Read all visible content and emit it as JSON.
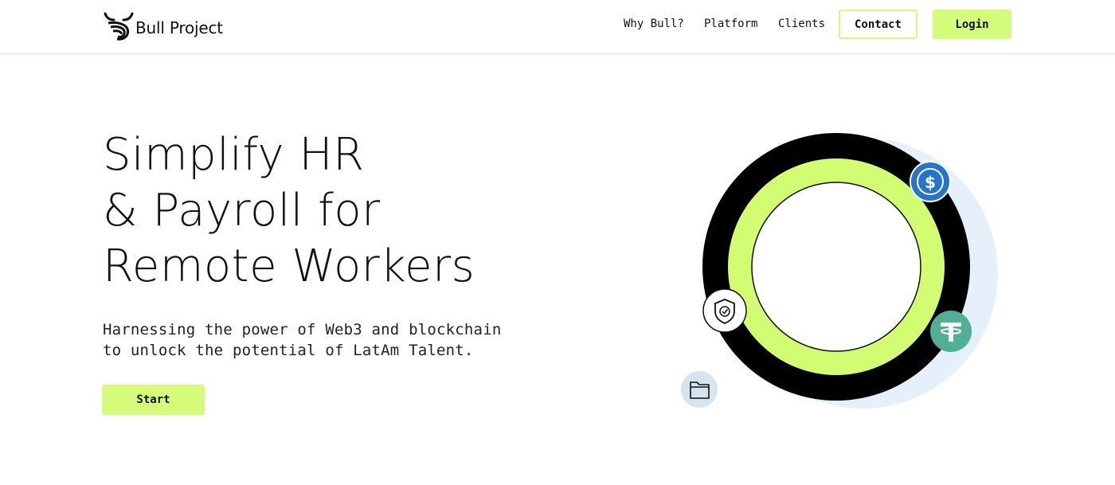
{
  "header": {
    "brand": "Bull Project",
    "nav": [
      {
        "label": "Why Bull?"
      },
      {
        "label": "Platform"
      },
      {
        "label": "Clients"
      }
    ],
    "contact_label": "Contact",
    "login_label": "Login"
  },
  "hero": {
    "title_lines": [
      "Simplify HR",
      "& Payroll for",
      "Remote Workers"
    ],
    "subtitle_lines": [
      "Harnessing the power of Web3 and blockchain",
      "to unlock the potential of LatAm Talent."
    ],
    "cta_label": "Start"
  },
  "illustration": {
    "icons": [
      "usdc-dollar-icon",
      "tether-icon",
      "shield-check-icon",
      "folder-icon"
    ]
  },
  "colors": {
    "accent": "#d4fb79",
    "ring_outer": "#000000",
    "ring_inner": "#d2fc72",
    "shadow_circle": "#e5f0fb",
    "usdc_blue": "#2775ca",
    "tether_green": "#50af95",
    "folder_bg": "#d6e4f0"
  }
}
